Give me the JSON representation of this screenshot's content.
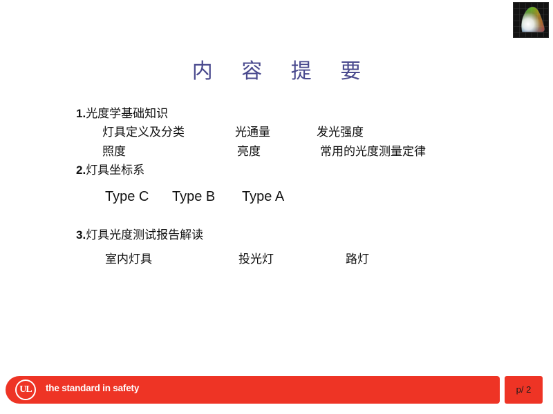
{
  "slide": {
    "title": "内 容 提 要",
    "title_color": "#4a4a8e",
    "background_color": "#ffffff"
  },
  "decor": {
    "cie_icon_name": "cie-chromaticity-diagram-icon"
  },
  "outline": {
    "sections": [
      {
        "number": "1.",
        "label": "光度学基础知识",
        "rows": [
          [
            "灯具定义及分类",
            "光通量",
            "发光强度"
          ],
          [
            "照度",
            "亮度",
            "常用的光度测量定律"
          ]
        ]
      },
      {
        "number": "2.",
        "label": "灯具坐标系",
        "types": [
          "Type C",
          "Type B",
          "Type A"
        ]
      },
      {
        "number": "3.",
        "label": "灯具光度测试报告解读",
        "rows": [
          [
            "室内灯具",
            "投光灯",
            "路灯"
          ]
        ]
      }
    ]
  },
  "footer": {
    "brand_mark": "UL",
    "tagline": "the standard in safety",
    "bar_color": "#ee3425",
    "page_label": "p/ 2"
  }
}
